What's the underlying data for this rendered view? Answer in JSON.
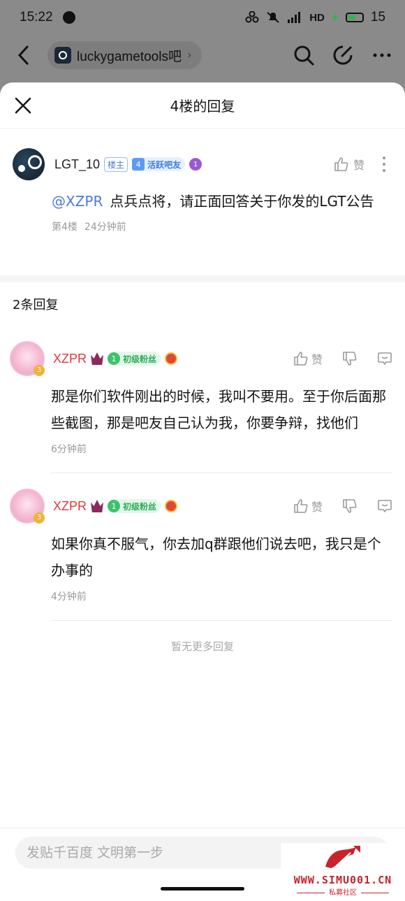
{
  "status_bar": {
    "time": "15:22",
    "network": "HD",
    "battery": "15"
  },
  "background_nav": {
    "forum_name": "luckygametools吧"
  },
  "sheet": {
    "title": "4楼的回复"
  },
  "main_post": {
    "username": "LGT_10",
    "owner_tag": "楼主",
    "level": "4",
    "level_title": "活跃吧友",
    "medal": "1",
    "like_label": "赞",
    "mention": "@XZPR",
    "content": "点兵点将，请正面回答关于你发的LGT公告",
    "floor": "第4楼",
    "time": "24分钟前"
  },
  "reply_count": "2条回复",
  "replies": [
    {
      "username": "XZPR",
      "fan_level": "1",
      "fan_title": "初级粉丝",
      "like_label": "赞",
      "content": "那是你们软件刚出的时候，我叫不要用。至于你后面那些截图，那是吧友自己认为我，你要争辩，找他们",
      "time": "6分钟前"
    },
    {
      "username": "XZPR",
      "fan_level": "1",
      "fan_title": "初级粉丝",
      "like_label": "赞",
      "content": "如果你真不服气，你去加q群跟他们说去吧，我只是个办事的",
      "time": "4分钟前"
    }
  ],
  "no_more": "暂无更多回复",
  "input": {
    "placeholder": "发贴千百度 文明第一步"
  },
  "watermark": {
    "site": "WWW.SIMU001.CN",
    "label": "私募社区"
  },
  "colors": {
    "accent_blue": "#4a7cdb",
    "username_red": "#e0383b",
    "fan_green": "#2faa5a",
    "watermark_red": "#c8232b"
  }
}
